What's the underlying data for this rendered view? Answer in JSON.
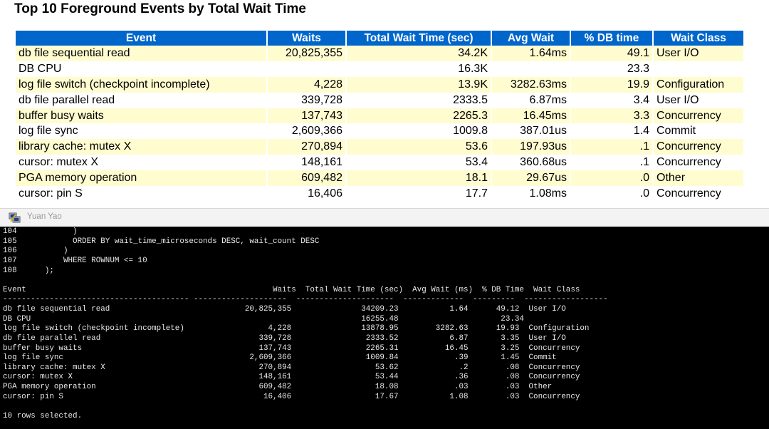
{
  "report": {
    "title": "Top 10 Foreground Events by Total Wait Time",
    "columns": [
      "Event",
      "Waits",
      "Total Wait Time (sec)",
      "Avg Wait",
      "% DB time",
      "Wait Class"
    ],
    "rows": [
      [
        "db file sequential read",
        "20,825,355",
        "34.2K",
        "1.64ms",
        "49.1",
        "User I/O"
      ],
      [
        "DB CPU",
        "",
        "16.3K",
        "",
        "23.3",
        ""
      ],
      [
        "log file switch (checkpoint incomplete)",
        "4,228",
        "13.9K",
        "3282.63ms",
        "19.9",
        "Configuration"
      ],
      [
        "db file parallel read",
        "339,728",
        "2333.5",
        "6.87ms",
        "3.4",
        "User I/O"
      ],
      [
        "buffer busy waits",
        "137,743",
        "2265.3",
        "16.45ms",
        "3.3",
        "Concurrency"
      ],
      [
        "log file sync",
        "2,609,366",
        "1009.8",
        "387.01us",
        "1.4",
        "Commit"
      ],
      [
        "library cache: mutex X",
        "270,894",
        "53.6",
        "197.93us",
        ".1",
        "Concurrency"
      ],
      [
        "cursor: mutex X",
        "148,161",
        "53.4",
        "360.68us",
        ".1",
        "Concurrency"
      ],
      [
        "PGA memory operation",
        "609,482",
        "18.1",
        "29.67us",
        ".0",
        "Other"
      ],
      [
        "cursor: pin S",
        "16,406",
        "17.7",
        "1.08ms",
        ".0",
        "Concurrency"
      ]
    ]
  },
  "terminal": {
    "title": "Yuan Yao",
    "sql_lines": [
      "104            )",
      "105            ORDER BY wait_time_microseconds DESC, wait_count DESC",
      "106          )",
      "107          WHERE ROWNUM <= 10",
      "108      );"
    ],
    "blank": "",
    "header": "Event                                                     Waits  Total Wait Time (sec)  Avg Wait (ms)  % DB Time  Wait Class",
    "separator": "---------------------------------------- --------------------  ---------------------  -------------  ---------  ------------------",
    "rows": [
      "db file sequential read                             20,825,355               34209.23           1.64      49.12  User I/O",
      "DB CPU                                                                       16255.48                      23.34",
      "log file switch (checkpoint incomplete)                  4,228               13878.95        3282.63      19.93  Configuration",
      "db file parallel read                                  339,728                2333.52           6.87       3.35  User I/O",
      "buffer busy waits                                      137,743                2265.31          16.45       3.25  Concurrency",
      "log file sync                                        2,609,366                1009.84            .39       1.45  Commit",
      "library cache: mutex X                                 270,894                  53.62             .2        .08  Concurrency",
      "cursor: mutex X                                        148,161                  53.44            .36        .08  Concurrency",
      "PGA memory operation                                   609,482                  18.08            .03        .03  Other",
      "cursor: pin S                                           16,406                  17.67           1.08        .03  Concurrency"
    ],
    "footer": "10 rows selected."
  }
}
